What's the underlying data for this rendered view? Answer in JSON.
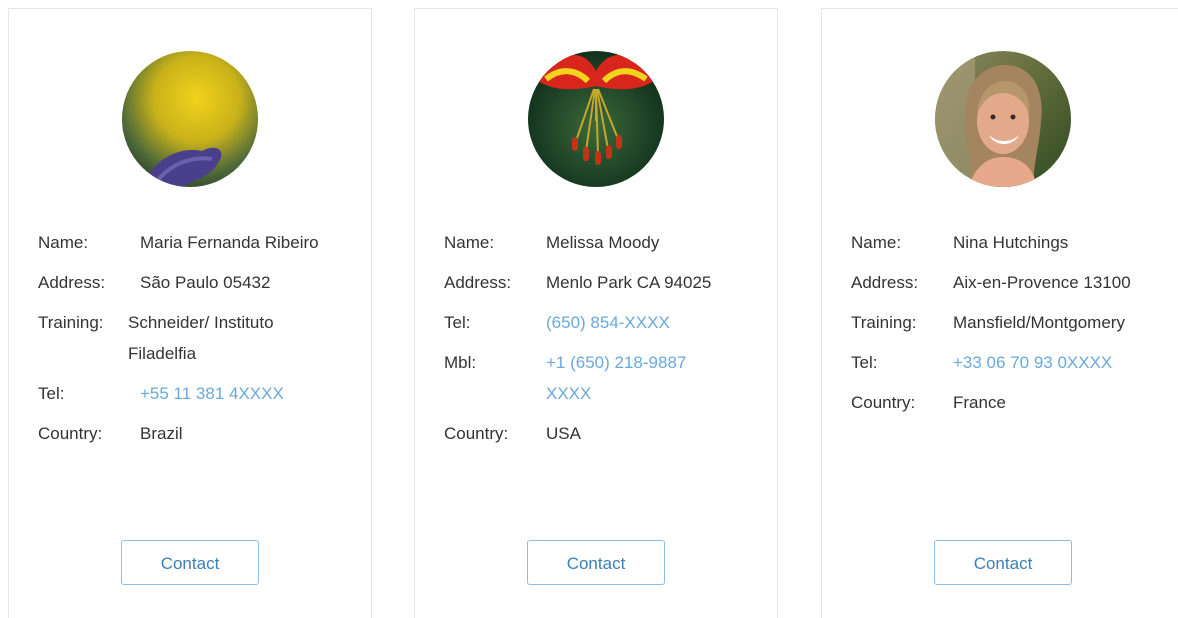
{
  "labels": {
    "name": "Name:",
    "address": "Address:",
    "training": "Training:",
    "tel": "Tel:",
    "mbl": "Mbl:",
    "country": "Country:"
  },
  "contact_label": "Contact",
  "link_color": "#6aa9dc",
  "cards": [
    {
      "avatar": "flower-photo-yellow",
      "name": "Maria Fernanda Ribeiro",
      "address": "São Paulo 05432",
      "training_line1": "Schneider/ Instituto",
      "training_line2": "Filadelfia",
      "tel": "+55 11 381 4XXXX",
      "country": "Brazil"
    },
    {
      "avatar": "flower-photo-red",
      "name": "Melissa Moody",
      "address": "Menlo Park CA 94025",
      "tel": "(650) 854-XXXX",
      "mbl_line1": "+1 (650) 218-9887",
      "mbl_line2": "XXXX",
      "country": "USA"
    },
    {
      "avatar": "person-photo",
      "name": "Nina Hutchings",
      "address": "Aix-en-Provence 13100",
      "training": "Mansfield/Montgomery",
      "tel": "+33 06 70 93 0XXXX",
      "country": "France"
    }
  ]
}
